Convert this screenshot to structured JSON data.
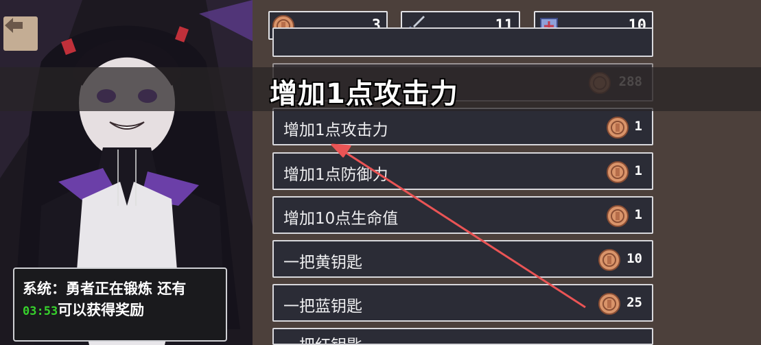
{
  "stats": {
    "coins": "3",
    "attack": "11",
    "defense": "10"
  },
  "banner": {
    "title": "增加1点攻击力",
    "ghost_price": "288"
  },
  "shop": {
    "items": [
      {
        "label": "增加1点攻击力",
        "price": "1"
      },
      {
        "label": "增加1点防御力",
        "price": "1"
      },
      {
        "label": "增加10点生命值",
        "price": "1"
      },
      {
        "label": "一把黄钥匙",
        "price": "10"
      },
      {
        "label": "一把蓝钥匙",
        "price": "25"
      },
      {
        "label": "一把红钥匙",
        "price": ""
      }
    ]
  },
  "system": {
    "line1": "系统：勇者正在锻炼 还有",
    "timer": "03:53",
    "line2_suffix": "可以获得奖励"
  },
  "icons": {
    "back": "back-arrow-icon",
    "coin": "coin-icon",
    "sword": "sword-icon",
    "shield": "shield-icon"
  },
  "colors": {
    "background": "#4c403b",
    "panel": "#2b2c36",
    "coin": "#d9946a",
    "timer": "#37d22c",
    "annotation_arrow": "#ea5455"
  }
}
